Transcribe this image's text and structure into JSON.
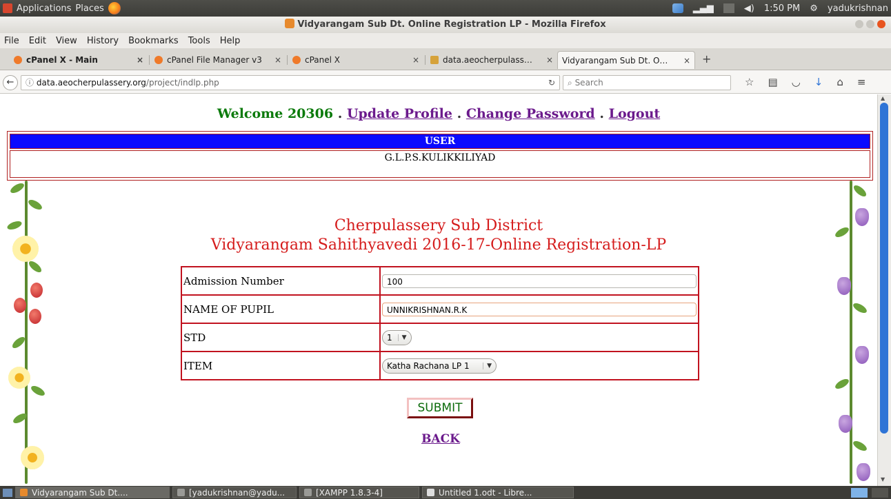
{
  "system_panel": {
    "applications": "Applications",
    "places": "Places",
    "clock": "1:50 PM",
    "user": "yadukrishnan"
  },
  "window": {
    "title": "Vidyarangam Sub Dt. Online Registration LP - Mozilla Firefox"
  },
  "menu": [
    "File",
    "Edit",
    "View",
    "History",
    "Bookmarks",
    "Tools",
    "Help"
  ],
  "tabs": [
    {
      "label": "cPanel X - Main",
      "active": false
    },
    {
      "label": "cPanel File Manager v3",
      "active": false
    },
    {
      "label": "cPanel X",
      "active": false
    },
    {
      "label": "data.aeocherpulass…",
      "active": false
    },
    {
      "label": "Vidyarangam Sub Dt. O…",
      "active": true
    }
  ],
  "nav": {
    "url_domain": "data.aeocherpulassery.org",
    "url_path": "/project/indlp.php",
    "search_placeholder": "Search"
  },
  "page": {
    "welcome": "Welcome 20306",
    "links": {
      "update_profile": "Update Profile",
      "change_password": "Change Password",
      "logout": "Logout"
    },
    "separator": ".",
    "user_header": "USER",
    "user_value": "G.L.P.S.KULIKKILIYAD",
    "heading_line1": "Cherpulassery Sub District",
    "heading_line2": "Vidyarangam Sahithyavedi 2016-17-Online Registration-LP",
    "form": {
      "admission_label": "Admission Number",
      "admission_value": "100",
      "name_label": "NAME OF PUPIL",
      "name_value": "UNNIKRISHNAN.R.K",
      "std_label": "STD",
      "std_value": "1",
      "item_label": "ITEM",
      "item_value": "Katha Rachana LP 1"
    },
    "submit": "SUBMIT",
    "back": "BACK"
  },
  "taskbar": [
    "Vidyarangam Sub Dt....",
    "[yadukrishnan@yadu...",
    "[XAMPP 1.8.3-4]",
    "Untitled 1.odt - Libre..."
  ]
}
